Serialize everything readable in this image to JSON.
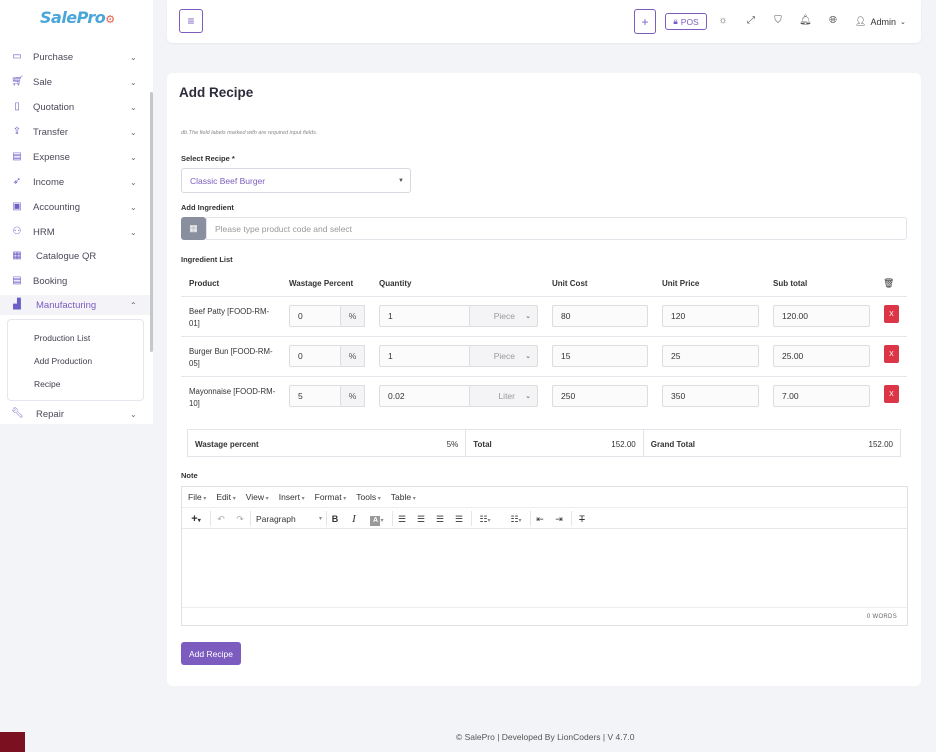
{
  "app": {
    "logo": "SalePro"
  },
  "sidebar": {
    "items": [
      {
        "label": "Purchase",
        "icon": "card-icon"
      },
      {
        "label": "Sale",
        "icon": "cart-icon"
      },
      {
        "label": "Quotation",
        "icon": "document-icon"
      },
      {
        "label": "Transfer",
        "icon": "share-icon"
      },
      {
        "label": "Expense",
        "icon": "wallet-icon"
      },
      {
        "label": "Income",
        "icon": "rocket-icon"
      },
      {
        "label": "Accounting",
        "icon": "briefcase-icon"
      },
      {
        "label": "HRM",
        "icon": "users-icon"
      },
      {
        "label": "Catalogue QR",
        "icon": "qr-icon"
      },
      {
        "label": "Booking",
        "icon": "calendar-icon"
      },
      {
        "label": "Manufacturing",
        "icon": "chart-icon"
      },
      {
        "label": "Repair",
        "icon": "wrench-icon"
      }
    ],
    "submenu": [
      "Production List",
      "Add Production",
      "Recipe"
    ]
  },
  "topbar": {
    "pos_label": "POS",
    "user": "Admin"
  },
  "form": {
    "title": "Add Recipe",
    "hint": "db.The field labels marked with are required input fields.",
    "select_recipe_label": "Select Recipe *",
    "select_recipe_value": "Classic Beef Burger",
    "add_ingredient_label": "Add Ingredient",
    "search_placeholder": "Please type product code and select",
    "ingredient_list_label": "Ingredient List",
    "columns": [
      "Product",
      "Wastage Percent",
      "Quantity",
      "Unit Cost",
      "Unit Price",
      "Sub total"
    ],
    "rows": [
      {
        "product": "Beef Patty [FOOD-RM-01]",
        "wastage": "0",
        "pct": "%",
        "quantity": "1",
        "unit": "Piece",
        "unit_cost": "80",
        "unit_price": "120",
        "subtotal": "120.00",
        "remove": "X"
      },
      {
        "product": "Burger Bun [FOOD-RM-05]",
        "wastage": "0",
        "pct": "%",
        "quantity": "1",
        "unit": "Piece",
        "unit_cost": "15",
        "unit_price": "25",
        "subtotal": "25.00",
        "remove": "X"
      },
      {
        "product": "Mayonnaise [FOOD-RM-10]",
        "wastage": "5",
        "pct": "%",
        "quantity": "0.02",
        "unit": "Liter",
        "unit_cost": "250",
        "unit_price": "350",
        "subtotal": "7.00",
        "remove": "X"
      }
    ],
    "totals": {
      "wastage_label": "Wastage percent",
      "wastage_value": "5%",
      "total_label": "Total",
      "total_value": "152.00",
      "grand_label": "Grand Total",
      "grand_value": "152.00"
    },
    "note_label": "Note",
    "editor": {
      "menus": [
        "File",
        "Edit",
        "View",
        "Insert",
        "Format",
        "Tools",
        "Table"
      ],
      "block_format": "Paragraph",
      "word_count": "0 WORDS"
    },
    "submit": "Add Recipe"
  },
  "footer": "© SalePro | Developed By LionCoders | V 4.7.0"
}
